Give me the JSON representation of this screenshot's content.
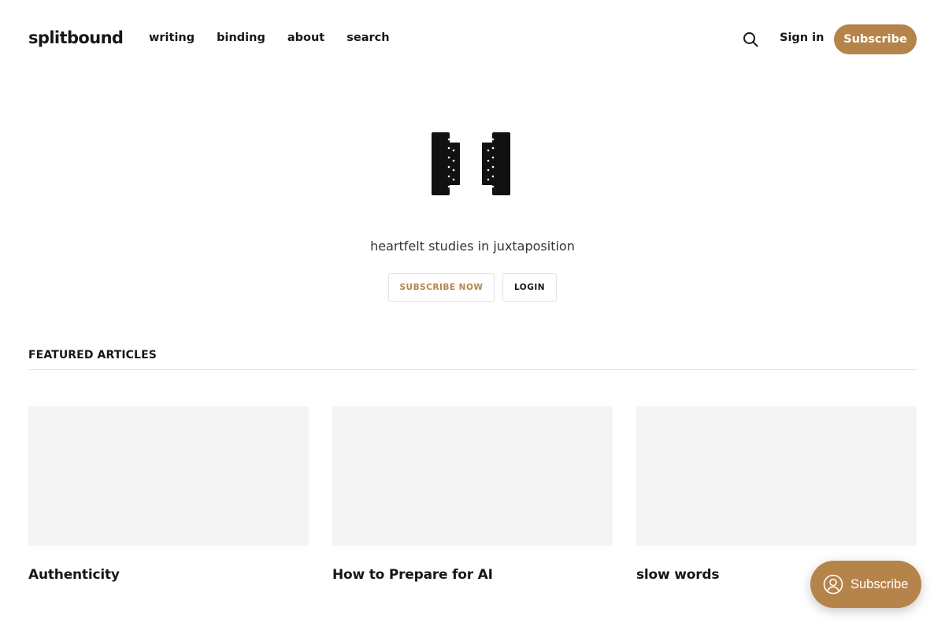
{
  "header": {
    "brand": "splitbound",
    "nav": [
      {
        "label": "writing"
      },
      {
        "label": "binding"
      },
      {
        "label": "about"
      },
      {
        "label": "search"
      }
    ],
    "search_icon": "search-icon",
    "signin_label": "Sign in",
    "subscribe_label": "Subscribe"
  },
  "hero": {
    "logo_icon": "split-hinge-logo-icon",
    "tagline": "heartfelt studies in juxtaposition",
    "subscribe_now_label": "SUBSCRIBE NOW",
    "login_label": "LOGIN"
  },
  "featured": {
    "title": "FEATURED ARTICLES",
    "articles": [
      {
        "title": "Authenticity"
      },
      {
        "title": "How to Prepare for AI"
      },
      {
        "title": "slow words"
      }
    ]
  },
  "portal": {
    "icon": "account-circle-icon",
    "label": "Subscribe"
  },
  "colors": {
    "accent": "#b5844a",
    "text": "#15171a",
    "image_placeholder": "#f4f4f4"
  }
}
